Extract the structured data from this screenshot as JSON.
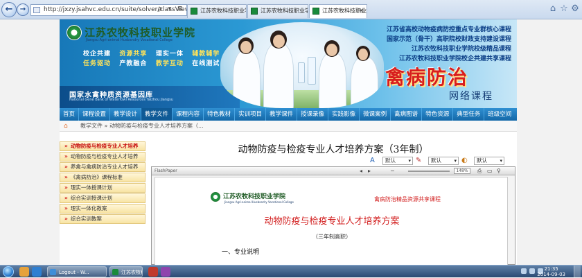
{
  "browser": {
    "url": "http://jxzy.jsahvc.edu.cn/suite/solver/classView.do?cl",
    "addr_tools": "ρ ▾ ⊠ C ×",
    "tabs": [
      {
        "label": "江苏农牧科技职业学院"
      },
      {
        "label": "江苏农牧科技职业学院"
      },
      {
        "label": "江苏农牧科技职业..."
      }
    ]
  },
  "banner": {
    "school_cn": "江苏农牧科技职业学院",
    "school_en": "Jiangsu Agri-animal Husbandry Vocational College",
    "motto_line1": [
      "校企共建",
      "资源共享",
      "理实一体",
      "辅教辅学"
    ],
    "motto_line2": [
      "任务驱动",
      "产教融合",
      "教学互动",
      "在线测试"
    ],
    "course_lines": [
      "江苏省高校动物疫病防控重点专业群核心课程",
      "国家示范（骨干）高职院校财政支持建设课程",
      "江苏农牧科技职业学院校级精品课程",
      "江苏农牧科技职业学院校企共建共享课程"
    ],
    "big_title": "禽病防治",
    "net_title": "网络课程",
    "base_title": "国家水禽种质资源基因库",
    "base_sub": "National Gene Bank of Waterfowl Resources Taizhou Jiangsu"
  },
  "menu": [
    "首页",
    "课程设置",
    "教学设计",
    "教学文件",
    "课程内容",
    "特色教材",
    "实训项目",
    "教学课件",
    "授课录像",
    "实践影像",
    "微课案例",
    "禽病图谱",
    "特色资源",
    "典型任务",
    "班级空间"
  ],
  "breadcrumb": "教学文件 » 动物防疫与检疫专业人才培养方案（...",
  "sidebar": [
    {
      "label": "动物防疫与检疫专业人才培养"
    },
    {
      "label": "动物防疫与检疫专业人才培养"
    },
    {
      "label": "养禽与禽病防治专业人才培养"
    },
    {
      "label": "《禽病防治》课程标准"
    },
    {
      "label": "理实一体授课计划"
    },
    {
      "label": "综合实训授课计划"
    },
    {
      "label": "理实一体化教案"
    },
    {
      "label": "综合实训教案"
    }
  ],
  "content": {
    "title": "动物防疫与检疫专业人才培养方案（3年制）",
    "toolbar": {
      "dd1": "默认",
      "dd2": "默认",
      "dd3": "默认"
    },
    "viewer": {
      "brand": "FlashPaper",
      "zoom": "148%",
      "page_school": "江苏农牧科技职业学院",
      "page_school_en": "Jiangsu Agri-animal Husbandry Vocational College",
      "page_course": "禽病防治精品资源共享课程",
      "page_title": "动物防疫与检疫专业人才培养方案",
      "page_sub": "（三年制高职）",
      "page_section": "一、专业说明"
    }
  },
  "taskbar": {
    "apps": [
      {
        "label": "Logout - W..."
      },
      {
        "label": "江苏农牧科..."
      }
    ],
    "time": "21:35",
    "date": "2014-09-03"
  },
  "colors": {
    "accent": "#1468a8",
    "red": "#d21d1d",
    "green": "#1f5b25"
  }
}
